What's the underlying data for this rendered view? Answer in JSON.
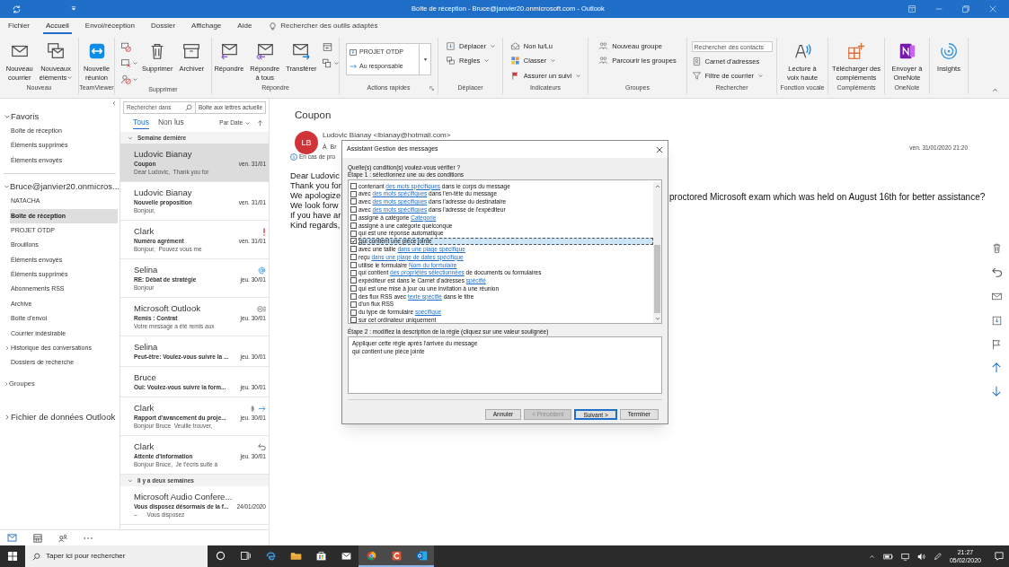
{
  "title_bar": {
    "title": "Boîte de réception - Bruce@janvier20.onmicrosoft.com - Outlook"
  },
  "menu_tabs": [
    {
      "label": "Fichier",
      "selected": false
    },
    {
      "label": "Accueil",
      "selected": true
    },
    {
      "label": "Envoi/réception",
      "selected": false
    },
    {
      "label": "Dossier",
      "selected": false
    },
    {
      "label": "Affichage",
      "selected": false
    },
    {
      "label": "Aide",
      "selected": false
    }
  ],
  "tell_me": {
    "placeholder": "Rechercher des outils adaptés"
  },
  "ribbon": {
    "groups": [
      {
        "label": "Nouveau",
        "launcher": false,
        "items": [
          {
            "kind": "large",
            "label": "Nouveau\ncourrier",
            "dropdown": false
          },
          {
            "kind": "large",
            "label": "Nouveaux\néléments",
            "dropdown": true
          }
        ]
      },
      {
        "label": "TeamViewer",
        "launcher": false,
        "items": [
          {
            "kind": "large",
            "label": "Nouvelle\nréunion",
            "dropdown": false
          }
        ]
      },
      {
        "label": "Supprimer",
        "launcher": false,
        "items": [
          {
            "kind": "icon",
            "dropdown": false
          },
          {
            "kind": "icon",
            "dropdown": true
          },
          {
            "kind": "icon",
            "dropdown": true
          },
          {
            "kind": "large",
            "label": "Supprimer",
            "dropdown": false
          },
          {
            "kind": "large",
            "label": "Archiver",
            "dropdown": false
          }
        ]
      },
      {
        "label": "Répondre",
        "launcher": false,
        "items": [
          {
            "kind": "large",
            "label": "Répondre",
            "dropdown": false
          },
          {
            "kind": "large",
            "label": "Répondre\nà tous",
            "dropdown": false
          },
          {
            "kind": "large",
            "label": "Transférer",
            "dropdown": false
          },
          {
            "kind": "icon",
            "dropdown": false
          },
          {
            "kind": "icon",
            "dropdown": true
          }
        ]
      },
      {
        "label": "Actions rapides",
        "launcher": true,
        "items": [
          {
            "kind": "quick",
            "steps": [
              "PROJET OTDP",
              "Au responsable"
            ]
          }
        ]
      },
      {
        "label": "Déplacer",
        "launcher": false,
        "items": [
          {
            "kind": "small",
            "label": "Déplacer",
            "dropdown": true
          },
          {
            "kind": "small",
            "label": "Règles",
            "dropdown": true
          }
        ]
      },
      {
        "label": "Indicateurs",
        "launcher": false,
        "items": [
          {
            "kind": "small",
            "label": "Non lu/Lu",
            "dropdown": false
          },
          {
            "kind": "small",
            "label": "Classer",
            "dropdown": true
          },
          {
            "kind": "small",
            "label": "Assurer un suivi",
            "dropdown": true
          }
        ]
      },
      {
        "label": "Groupes",
        "launcher": false,
        "items": [
          {
            "kind": "small",
            "label": "Nouveau groupe",
            "dropdown": false
          },
          {
            "kind": "small",
            "label": "Parcourir les groupes",
            "dropdown": false
          }
        ]
      },
      {
        "label": "Rechercher",
        "launcher": false,
        "items": [
          {
            "kind": "search",
            "placeholder": "Rechercher des contacts"
          },
          {
            "kind": "small",
            "label": "Carnet d'adresses",
            "dropdown": false
          },
          {
            "kind": "small",
            "label": "Filtre de courrier",
            "dropdown": true
          }
        ]
      },
      {
        "label": "Fonction vocale",
        "launcher": false,
        "items": [
          {
            "kind": "large",
            "label": "Lecture à\nvoix haute",
            "dropdown": false
          }
        ]
      },
      {
        "label": "Compléments",
        "launcher": false,
        "items": [
          {
            "kind": "large",
            "label": "Télécharger des\ncompléments",
            "dropdown": false
          }
        ]
      },
      {
        "label": "OneNote",
        "launcher": false,
        "items": [
          {
            "kind": "large",
            "label": "Envoyer à\nOneNote",
            "dropdown": false
          }
        ]
      },
      {
        "items": [
          {
            "kind": "large",
            "label": "Insights",
            "dropdown": false
          }
        ]
      }
    ]
  },
  "folder_pane": {
    "sections": [
      {
        "label": "Favoris",
        "kind": "major",
        "expanded": true,
        "items": [
          {
            "label": "Boîte de réception",
            "selected": false,
            "expandable": false
          },
          {
            "label": "Éléments supprimés",
            "selected": false,
            "expandable": false
          },
          {
            "label": "Éléments envoyés",
            "selected": false,
            "expandable": false
          }
        ]
      },
      {
        "label": "Bruce@janvier20.onmicros...",
        "kind": "major",
        "expanded": true,
        "items": [
          {
            "label": "NATACHA",
            "selected": false,
            "expandable": false
          },
          {
            "label": "Boîte de réception",
            "selected": true,
            "expandable": false
          },
          {
            "label": "PROJET OTDP",
            "selected": false,
            "expandable": false
          },
          {
            "label": "Brouillons",
            "selected": false,
            "expandable": false
          },
          {
            "label": "Éléments envoyés",
            "selected": false,
            "expandable": false
          },
          {
            "label": "Éléments supprimés",
            "selected": false,
            "expandable": false
          },
          {
            "label": "Abonnements RSS",
            "selected": false,
            "expandable": false
          },
          {
            "label": "Archive",
            "selected": false,
            "expandable": false
          },
          {
            "label": "Boîte d'envoi",
            "selected": false,
            "expandable": false
          },
          {
            "label": "Courrier indésirable",
            "selected": false,
            "expandable": false
          },
          {
            "label": "Historique des conversations",
            "selected": false,
            "expandable": true
          },
          {
            "label": "Dossiers de recherche",
            "selected": false
          }
        ]
      },
      {
        "label": "Groupes",
        "kind": "minor",
        "expanded": false
      },
      {
        "label": "Fichier de données Outlook",
        "kind": "major",
        "expanded": false
      }
    ]
  },
  "message_list": {
    "search": {
      "placeholder": "Rechercher dans",
      "scope": "Boîte aux lettres actuelle"
    },
    "filters": [
      {
        "label": "Tous",
        "selected": true
      },
      {
        "label": "Non lus",
        "selected": false
      }
    ],
    "sort": "Par Date",
    "groups": [
      {
        "label": "Semaine dernière",
        "expanded": true,
        "messages": [
          {
            "sender": "Ludovic Bianay",
            "subject": "Coupon",
            "preview": "Dear Ludovic,  Thank you for",
            "date": "ven. 31/01",
            "selected": true
          },
          {
            "sender": "Ludovic Bianay",
            "subject": "Nouvelle proposition",
            "preview": "Bonjour,",
            "date": "ven. 31/01",
            "selected": false
          },
          {
            "sender": "Clark",
            "subject": "Numéro agrément",
            "preview": "Bonjour,  Pouvez vous me",
            "date": "ven. 31/01",
            "selected": false,
            "important": true
          },
          {
            "sender": "Selina",
            "subject": "RE: Débat de stratégie",
            "preview": "Bonjour",
            "date": "jeu. 30/01",
            "selected": false,
            "mentioned": true
          },
          {
            "sender": "Microsoft Outlook",
            "subject": "Remis : Contrat",
            "preview": "Votre message a été remis aux",
            "date": "jeu. 30/01",
            "selected": false,
            "receipt": true
          },
          {
            "sender": "Selina",
            "subject": "Peut-être: Voulez-vous suivre la ...",
            "date": "jeu. 30/01",
            "selected": false
          },
          {
            "sender": "Bruce",
            "subject": "Oui: Voulez-vous suivre la form...",
            "date": "jeu. 30/01",
            "selected": false
          },
          {
            "sender": "Clark",
            "subject": "Rapport d'avancement du proje...",
            "preview": "Bonjour Bruce  Veuille trouver,",
            "date": "jeu. 30/01",
            "selected": false,
            "forwarded": true,
            "attachment": true
          },
          {
            "sender": "Clark",
            "subject": "Attente d'information",
            "preview": "Bonjour Bruce,  Je t'écris suite à",
            "date": "jeu. 30/01",
            "selected": false,
            "replied": true
          }
        ]
      },
      {
        "label": "Il y a deux semaines",
        "expanded": true,
        "messages": [
          {
            "sender": "Microsoft Audio Confere...",
            "subject": "Vous disposez désormais de la f...",
            "preview": "–      Vous disposez",
            "date": "24/01/2020",
            "selected": false
          }
        ]
      }
    ]
  },
  "reading_pane": {
    "subject": "Coupon",
    "avatar": "LB",
    "from": "Ludovic Bianay <lbianay@hotmail.com>",
    "to": "À  Br",
    "info": "En cas de pro",
    "date": "ven. 31/01/2020 21:20",
    "body_lines": [
      "Dear Ludovic",
      "Thank you for",
      "We apologize",
      "We look forw",
      "If you have ar",
      "Kind regards,"
    ],
    "body_right": "proctored Microsoft exam which was held on August 16th for better assistance?"
  },
  "nav_bar": [
    {
      "selected": true
    },
    {
      "selected": false
    },
    {
      "selected": false
    },
    {
      "selected": false
    }
  ],
  "rules_dialog": {
    "title": "Assistant Gestion des messages",
    "question": "Quelle(s) condition(s) voulez-vous vérifier ?",
    "step1": "Étape 1 : sélectionnez une ou des conditions",
    "conditions": [
      {
        "checked": false,
        "selected": false,
        "parts": [
          {
            "kind": "text",
            "text": "contenant "
          },
          {
            "kind": "link",
            "text": "des mots spécifiques"
          },
          {
            "kind": "text",
            "text": " dans le corps du message"
          }
        ]
      },
      {
        "checked": false,
        "selected": false,
        "parts": [
          {
            "kind": "text",
            "text": "avec "
          },
          {
            "kind": "link",
            "text": "des mots spécifiques"
          },
          {
            "kind": "text",
            "text": " dans l'en-tête du message"
          }
        ]
      },
      {
        "checked": false,
        "selected": false,
        "parts": [
          {
            "kind": "text",
            "text": "avec "
          },
          {
            "kind": "link",
            "text": "des mots spécifiques"
          },
          {
            "kind": "text",
            "text": " dans l'adresse du destinataire"
          }
        ]
      },
      {
        "checked": false,
        "selected": false,
        "parts": [
          {
            "kind": "text",
            "text": "avec "
          },
          {
            "kind": "link",
            "text": "des mots spécifiques"
          },
          {
            "kind": "text",
            "text": " dans l'adresse de l'expéditeur"
          }
        ]
      },
      {
        "checked": false,
        "selected": false,
        "parts": [
          {
            "kind": "text",
            "text": "assigné à catégorie "
          },
          {
            "kind": "link",
            "text": "Catégorie"
          }
        ]
      },
      {
        "checked": false,
        "selected": false,
        "parts": [
          {
            "kind": "text",
            "text": "assigné à une catégorie quelconque"
          }
        ]
      },
      {
        "checked": false,
        "selected": false,
        "parts": [
          {
            "kind": "text",
            "text": "qui est une réponse automatique"
          }
        ]
      },
      {
        "checked": true,
        "selected": true,
        "parts": [
          {
            "kind": "text",
            "text": "qui contient une pièce jointe"
          }
        ]
      },
      {
        "checked": false,
        "selected": false,
        "parts": [
          {
            "kind": "text",
            "text": "avec une taille "
          },
          {
            "kind": "link",
            "text": "dans une plage spécifique"
          }
        ]
      },
      {
        "checked": false,
        "selected": false,
        "parts": [
          {
            "kind": "text",
            "text": "reçu "
          },
          {
            "kind": "link",
            "text": "dans une plage de dates spécifique"
          }
        ]
      },
      {
        "checked": false,
        "selected": false,
        "parts": [
          {
            "kind": "text",
            "text": "utilise le formulaire "
          },
          {
            "kind": "link",
            "text": "Nom du formulaire"
          }
        ]
      },
      {
        "checked": false,
        "selected": false,
        "parts": [
          {
            "kind": "text",
            "text": "qui contient "
          },
          {
            "kind": "link",
            "text": "des propriétés sélectionnées"
          },
          {
            "kind": "text",
            "text": " de documents ou formulaires"
          }
        ]
      },
      {
        "checked": false,
        "selected": false,
        "parts": [
          {
            "kind": "text",
            "text": "expéditeur est dans le Carnet d'adresses "
          },
          {
            "kind": "link",
            "text": "spécifié"
          }
        ]
      },
      {
        "checked": false,
        "selected": false,
        "parts": [
          {
            "kind": "text",
            "text": "qui est une mise à jour ou une invitation à une réunion"
          }
        ]
      },
      {
        "checked": false,
        "selected": false,
        "parts": [
          {
            "kind": "text",
            "text": "des flux RSS avec "
          },
          {
            "kind": "link",
            "text": "texte spécifié"
          },
          {
            "kind": "text",
            "text": " dans le titre"
          }
        ]
      },
      {
        "checked": false,
        "selected": false,
        "parts": [
          {
            "kind": "text",
            "text": "d'un flux RSS"
          }
        ]
      },
      {
        "checked": false,
        "selected": false,
        "parts": [
          {
            "kind": "text",
            "text": "du type de formulaire "
          },
          {
            "kind": "link",
            "text": "spécifique"
          }
        ]
      },
      {
        "checked": false,
        "selected": false,
        "parts": [
          {
            "kind": "text",
            "text": "sur cet ordinateur uniquement"
          }
        ]
      }
    ],
    "step2": "Étape 2 : modifiez la description de la règle (cliquez sur une valeur soulignée)",
    "description": [
      "Appliquer cette règle après l'arrivée du message",
      "qui contient une pièce jointe"
    ],
    "buttons": [
      {
        "label": "Annuler",
        "disabled": false,
        "default": false
      },
      {
        "label": "< Précédent",
        "disabled": true,
        "default": false
      },
      {
        "label": "Suivant >",
        "disabled": false,
        "default": true
      },
      {
        "label": "Terminer",
        "disabled": false,
        "default": false
      }
    ]
  },
  "taskbar": {
    "search_placeholder": "Taper ici pour rechercher",
    "apps": [
      {
        "open": false
      },
      {
        "open": false
      },
      {
        "open": false
      },
      {
        "open": false
      },
      {
        "open": false
      },
      {
        "open": false
      },
      {
        "open": true
      },
      {
        "open": true
      },
      {
        "open": true
      }
    ],
    "time": "21:27",
    "date": "05/02/2020"
  }
}
